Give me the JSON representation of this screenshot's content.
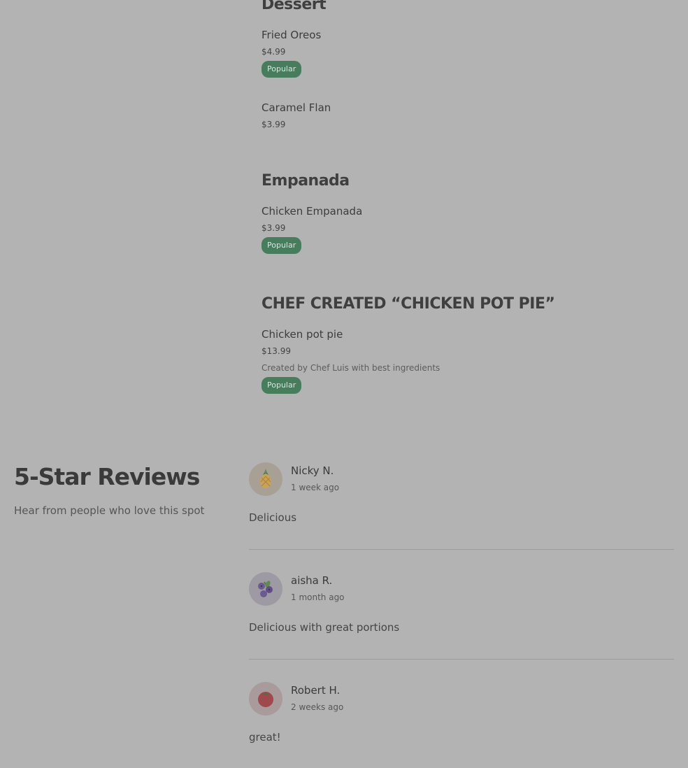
{
  "menu": {
    "sections": [
      {
        "title": "Dessert",
        "items": [
          {
            "name": "Fried Oreos",
            "price": "$4.99",
            "badge": "Popular"
          },
          {
            "name": "Caramel Flan",
            "price": "$3.99"
          }
        ]
      },
      {
        "title": "Empanada",
        "items": [
          {
            "name": "Chicken Empanada",
            "price": "$3.99",
            "badge": "Popular"
          }
        ]
      },
      {
        "title": "CHEF CREATED “CHICKEN POT PIE”",
        "items": [
          {
            "name": "Chicken pot pie",
            "price": "$13.99",
            "description": "Created by Chef Luis with best ingredients",
            "badge": "Popular"
          }
        ]
      }
    ]
  },
  "reviews": {
    "title": "5-Star Reviews",
    "subtitle": "Hear from people who love this spot",
    "items": [
      {
        "name": "Nicky N.",
        "time": "1 week ago",
        "text": "Delicious",
        "avatar_icon": "pineapple-icon",
        "avatar_color": "#a8a095"
      },
      {
        "name": "aisha R.",
        "time": "1 month ago",
        "text": "Delicious with great portions",
        "avatar_icon": "blueberries-icon",
        "avatar_color": "#9d9aa3"
      },
      {
        "name": "Robert H.",
        "time": "2 weeks ago",
        "text": "great!",
        "avatar_icon": "tomato-icon",
        "avatar_color": "#a99b9b"
      }
    ]
  },
  "colors": {
    "background": "#b3b3b3",
    "badge_background": "#477c5d",
    "badge_text": "#d6e6dc"
  }
}
